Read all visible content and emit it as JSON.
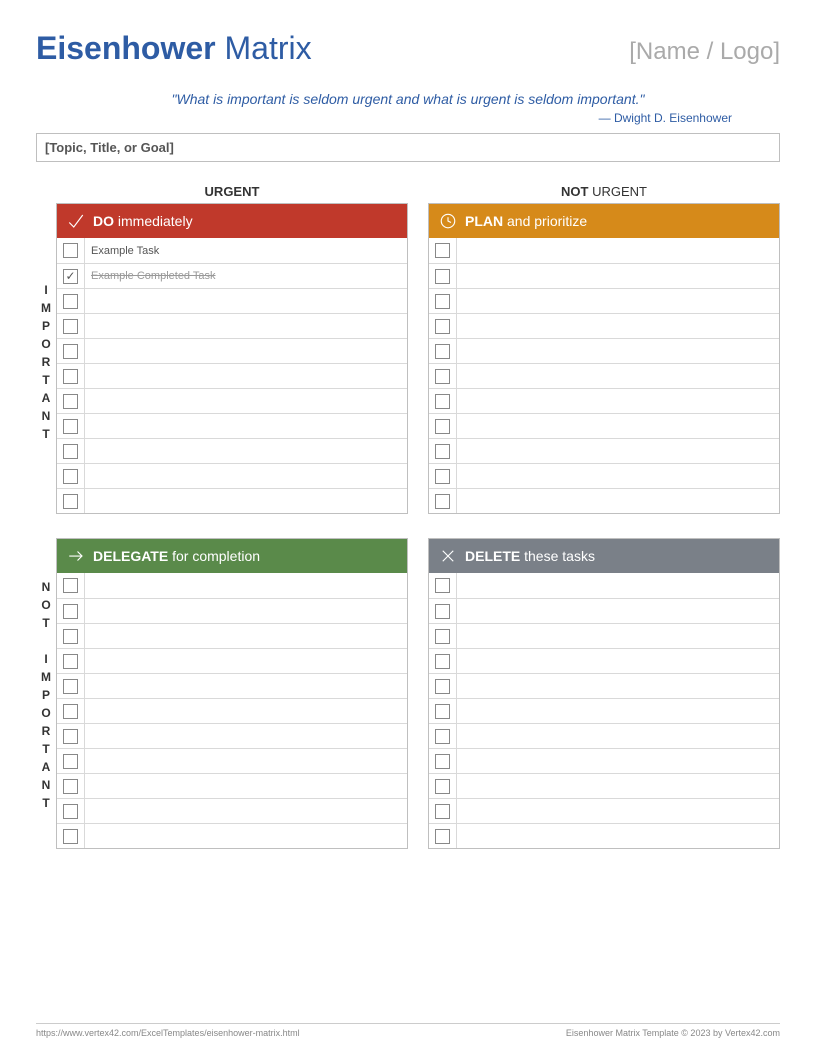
{
  "header": {
    "title_bold": "Eisenhower",
    "title_rest": " Matrix",
    "logo": "[Name / Logo]"
  },
  "quote": {
    "text": "\"What is important is seldom urgent and what is urgent is seldom important.\"",
    "author": "— Dwight D. Eisenhower"
  },
  "topic": "[Topic, Title, or Goal]",
  "columns": {
    "urgent_b": "URGENT",
    "not": "NOT ",
    "not_urgent_b": "URGENT"
  },
  "rows": {
    "important": "IMPORTANT",
    "not": "NOT",
    "not_important": "IMPORTANT"
  },
  "quadrants": {
    "do": {
      "bold": "DO",
      "rest": " immediately"
    },
    "plan": {
      "bold": "PLAN",
      "rest": " and prioritize"
    },
    "delegate": {
      "bold": "DELEGATE",
      "rest": " for completion"
    },
    "delete": {
      "bold": "DELETE",
      "rest": " these tasks"
    }
  },
  "tasks": {
    "do": [
      {
        "text": "Example Task",
        "done": false
      },
      {
        "text": "Example Completed Task",
        "done": true
      },
      {
        "text": "",
        "done": false
      },
      {
        "text": "",
        "done": false
      },
      {
        "text": "",
        "done": false
      },
      {
        "text": "",
        "done": false
      },
      {
        "text": "",
        "done": false
      },
      {
        "text": "",
        "done": false
      },
      {
        "text": "",
        "done": false
      },
      {
        "text": "",
        "done": false
      },
      {
        "text": "",
        "done": false
      }
    ],
    "plan": [
      {
        "text": "",
        "done": false
      },
      {
        "text": "",
        "done": false
      },
      {
        "text": "",
        "done": false
      },
      {
        "text": "",
        "done": false
      },
      {
        "text": "",
        "done": false
      },
      {
        "text": "",
        "done": false
      },
      {
        "text": "",
        "done": false
      },
      {
        "text": "",
        "done": false
      },
      {
        "text": "",
        "done": false
      },
      {
        "text": "",
        "done": false
      },
      {
        "text": "",
        "done": false
      }
    ],
    "delegate": [
      {
        "text": "",
        "done": false
      },
      {
        "text": "",
        "done": false
      },
      {
        "text": "",
        "done": false
      },
      {
        "text": "",
        "done": false
      },
      {
        "text": "",
        "done": false
      },
      {
        "text": "",
        "done": false
      },
      {
        "text": "",
        "done": false
      },
      {
        "text": "",
        "done": false
      },
      {
        "text": "",
        "done": false
      },
      {
        "text": "",
        "done": false
      },
      {
        "text": "",
        "done": false
      }
    ],
    "delete": [
      {
        "text": "",
        "done": false
      },
      {
        "text": "",
        "done": false
      },
      {
        "text": "",
        "done": false
      },
      {
        "text": "",
        "done": false
      },
      {
        "text": "",
        "done": false
      },
      {
        "text": "",
        "done": false
      },
      {
        "text": "",
        "done": false
      },
      {
        "text": "",
        "done": false
      },
      {
        "text": "",
        "done": false
      },
      {
        "text": "",
        "done": false
      },
      {
        "text": "",
        "done": false
      }
    ]
  },
  "footer": {
    "url": "https://www.vertex42.com/ExcelTemplates/eisenhower-matrix.html",
    "copyright": "Eisenhower Matrix Template © 2023 by Vertex42.com"
  }
}
